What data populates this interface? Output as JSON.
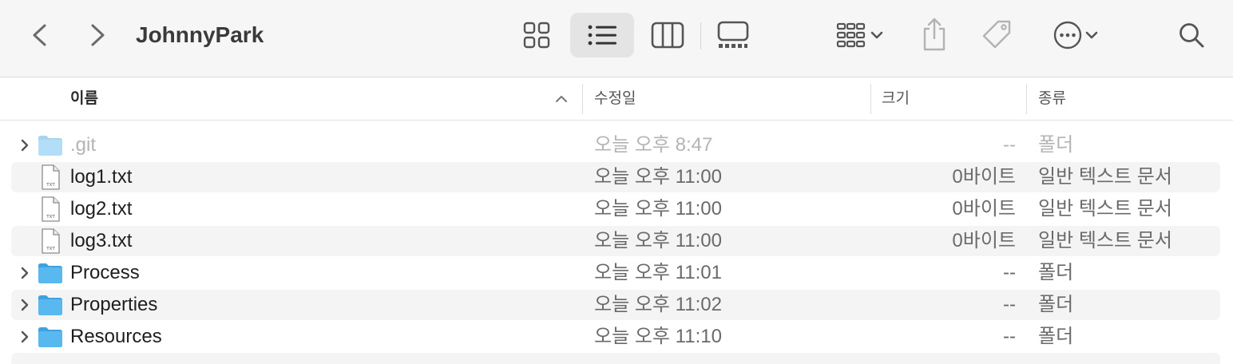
{
  "window": {
    "title": "JohnnyPark"
  },
  "toolbar": {
    "icons": {
      "back": "chevron-left-icon",
      "forward": "chevron-right-icon",
      "icon_view": "grid-icon",
      "list_view": "list-icon",
      "column_view": "columns-icon",
      "gallery_view": "gallery-icon",
      "group": "group-icon",
      "share": "share-icon",
      "tag": "tag-icon",
      "more": "ellipsis-circle-icon",
      "search": "search-icon"
    },
    "selected_view": "list"
  },
  "columns": {
    "name": "이름",
    "date": "수정일",
    "size": "크기",
    "kind": "종류",
    "sort": "name-ascending"
  },
  "files": [
    {
      "name": ".git",
      "date": "오늘 오후 8:47",
      "size": "--",
      "kind": "폴더",
      "type": "folder",
      "hidden": true
    },
    {
      "name": "log1.txt",
      "date": "오늘 오후 11:00",
      "size": "0바이트",
      "kind": "일반 텍스트 문서",
      "type": "txt"
    },
    {
      "name": "log2.txt",
      "date": "오늘 오후 11:00",
      "size": "0바이트",
      "kind": "일반 텍스트 문서",
      "type": "txt"
    },
    {
      "name": "log3.txt",
      "date": "오늘 오후 11:00",
      "size": "0바이트",
      "kind": "일반 텍스트 문서",
      "type": "txt"
    },
    {
      "name": "Process",
      "date": "오늘 오후 11:01",
      "size": "--",
      "kind": "폴더",
      "type": "folder"
    },
    {
      "name": "Properties",
      "date": "오늘 오후 11:02",
      "size": "--",
      "kind": "폴더",
      "type": "folder"
    },
    {
      "name": "Resources",
      "date": "오늘 오후 11:10",
      "size": "--",
      "kind": "폴더",
      "type": "folder"
    }
  ],
  "file_icon_text": "TXT",
  "colors": {
    "folder": "#5ab8f0",
    "folder_dark": "#3fa2e0",
    "toolbar_bg": "#f6f6f6",
    "row_alt": "#f4f4f4"
  }
}
